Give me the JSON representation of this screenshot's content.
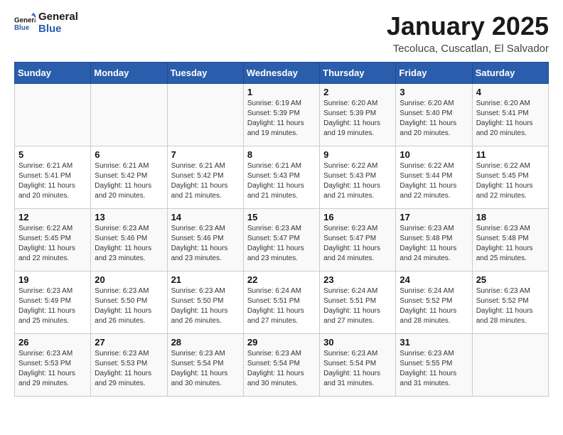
{
  "header": {
    "logo_general": "General",
    "logo_blue": "Blue",
    "month_title": "January 2025",
    "location": "Tecoluca, Cuscatlan, El Salvador"
  },
  "weekdays": [
    "Sunday",
    "Monday",
    "Tuesday",
    "Wednesday",
    "Thursday",
    "Friday",
    "Saturday"
  ],
  "weeks": [
    [
      {
        "day": "",
        "info": ""
      },
      {
        "day": "",
        "info": ""
      },
      {
        "day": "",
        "info": ""
      },
      {
        "day": "1",
        "info": "Sunrise: 6:19 AM\nSunset: 5:39 PM\nDaylight: 11 hours\nand 19 minutes."
      },
      {
        "day": "2",
        "info": "Sunrise: 6:20 AM\nSunset: 5:39 PM\nDaylight: 11 hours\nand 19 minutes."
      },
      {
        "day": "3",
        "info": "Sunrise: 6:20 AM\nSunset: 5:40 PM\nDaylight: 11 hours\nand 20 minutes."
      },
      {
        "day": "4",
        "info": "Sunrise: 6:20 AM\nSunset: 5:41 PM\nDaylight: 11 hours\nand 20 minutes."
      }
    ],
    [
      {
        "day": "5",
        "info": "Sunrise: 6:21 AM\nSunset: 5:41 PM\nDaylight: 11 hours\nand 20 minutes."
      },
      {
        "day": "6",
        "info": "Sunrise: 6:21 AM\nSunset: 5:42 PM\nDaylight: 11 hours\nand 20 minutes."
      },
      {
        "day": "7",
        "info": "Sunrise: 6:21 AM\nSunset: 5:42 PM\nDaylight: 11 hours\nand 21 minutes."
      },
      {
        "day": "8",
        "info": "Sunrise: 6:21 AM\nSunset: 5:43 PM\nDaylight: 11 hours\nand 21 minutes."
      },
      {
        "day": "9",
        "info": "Sunrise: 6:22 AM\nSunset: 5:43 PM\nDaylight: 11 hours\nand 21 minutes."
      },
      {
        "day": "10",
        "info": "Sunrise: 6:22 AM\nSunset: 5:44 PM\nDaylight: 11 hours\nand 22 minutes."
      },
      {
        "day": "11",
        "info": "Sunrise: 6:22 AM\nSunset: 5:45 PM\nDaylight: 11 hours\nand 22 minutes."
      }
    ],
    [
      {
        "day": "12",
        "info": "Sunrise: 6:22 AM\nSunset: 5:45 PM\nDaylight: 11 hours\nand 22 minutes."
      },
      {
        "day": "13",
        "info": "Sunrise: 6:23 AM\nSunset: 5:46 PM\nDaylight: 11 hours\nand 23 minutes."
      },
      {
        "day": "14",
        "info": "Sunrise: 6:23 AM\nSunset: 5:46 PM\nDaylight: 11 hours\nand 23 minutes."
      },
      {
        "day": "15",
        "info": "Sunrise: 6:23 AM\nSunset: 5:47 PM\nDaylight: 11 hours\nand 23 minutes."
      },
      {
        "day": "16",
        "info": "Sunrise: 6:23 AM\nSunset: 5:47 PM\nDaylight: 11 hours\nand 24 minutes."
      },
      {
        "day": "17",
        "info": "Sunrise: 6:23 AM\nSunset: 5:48 PM\nDaylight: 11 hours\nand 24 minutes."
      },
      {
        "day": "18",
        "info": "Sunrise: 6:23 AM\nSunset: 5:48 PM\nDaylight: 11 hours\nand 25 minutes."
      }
    ],
    [
      {
        "day": "19",
        "info": "Sunrise: 6:23 AM\nSunset: 5:49 PM\nDaylight: 11 hours\nand 25 minutes."
      },
      {
        "day": "20",
        "info": "Sunrise: 6:23 AM\nSunset: 5:50 PM\nDaylight: 11 hours\nand 26 minutes."
      },
      {
        "day": "21",
        "info": "Sunrise: 6:23 AM\nSunset: 5:50 PM\nDaylight: 11 hours\nand 26 minutes."
      },
      {
        "day": "22",
        "info": "Sunrise: 6:24 AM\nSunset: 5:51 PM\nDaylight: 11 hours\nand 27 minutes."
      },
      {
        "day": "23",
        "info": "Sunrise: 6:24 AM\nSunset: 5:51 PM\nDaylight: 11 hours\nand 27 minutes."
      },
      {
        "day": "24",
        "info": "Sunrise: 6:24 AM\nSunset: 5:52 PM\nDaylight: 11 hours\nand 28 minutes."
      },
      {
        "day": "25",
        "info": "Sunrise: 6:23 AM\nSunset: 5:52 PM\nDaylight: 11 hours\nand 28 minutes."
      }
    ],
    [
      {
        "day": "26",
        "info": "Sunrise: 6:23 AM\nSunset: 5:53 PM\nDaylight: 11 hours\nand 29 minutes."
      },
      {
        "day": "27",
        "info": "Sunrise: 6:23 AM\nSunset: 5:53 PM\nDaylight: 11 hours\nand 29 minutes."
      },
      {
        "day": "28",
        "info": "Sunrise: 6:23 AM\nSunset: 5:54 PM\nDaylight: 11 hours\nand 30 minutes."
      },
      {
        "day": "29",
        "info": "Sunrise: 6:23 AM\nSunset: 5:54 PM\nDaylight: 11 hours\nand 30 minutes."
      },
      {
        "day": "30",
        "info": "Sunrise: 6:23 AM\nSunset: 5:54 PM\nDaylight: 11 hours\nand 31 minutes."
      },
      {
        "day": "31",
        "info": "Sunrise: 6:23 AM\nSunset: 5:55 PM\nDaylight: 11 hours\nand 31 minutes."
      },
      {
        "day": "",
        "info": ""
      }
    ]
  ]
}
